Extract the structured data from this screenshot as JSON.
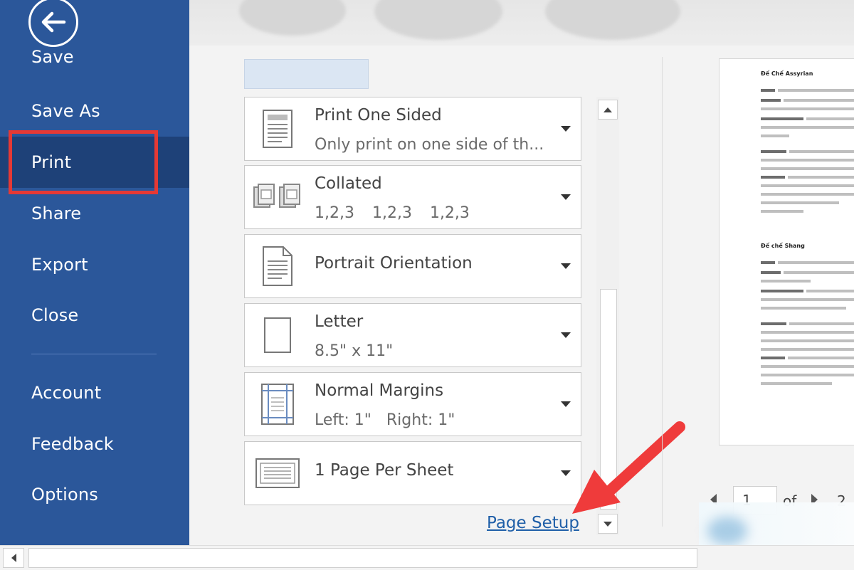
{
  "sidebar": {
    "items": [
      {
        "label": "Save",
        "name": "sidebar-item-save"
      },
      {
        "label": "Save As",
        "name": "sidebar-item-save-as"
      },
      {
        "label": "Print",
        "name": "sidebar-item-print"
      },
      {
        "label": "Share",
        "name": "sidebar-item-share"
      },
      {
        "label": "Export",
        "name": "sidebar-item-export"
      },
      {
        "label": "Close",
        "name": "sidebar-item-close"
      },
      {
        "label": "Account",
        "name": "sidebar-item-account"
      },
      {
        "label": "Feedback",
        "name": "sidebar-item-feedback"
      },
      {
        "label": "Options",
        "name": "sidebar-item-options"
      }
    ],
    "active": "Print",
    "back_icon": "back-arrow-icon"
  },
  "settings": [
    {
      "title": "Print One Sided",
      "sub": "Only print on one side of th...",
      "icon": "one-sided-page-icon"
    },
    {
      "title": "Collated",
      "sub": "1,2,3 1,2,3 1,2,3",
      "icon": "collated-pages-icon"
    },
    {
      "title": "Portrait Orientation",
      "sub": "",
      "icon": "portrait-page-icon"
    },
    {
      "title": "Letter",
      "sub": "8.5\" x 11\"",
      "icon": "letter-page-icon"
    },
    {
      "title": "Normal Margins",
      "sub": "Left: 1\"   Right: 1\"",
      "icon": "margins-icon"
    },
    {
      "title": "1 Page Per Sheet",
      "sub": "",
      "icon": "pages-per-sheet-icon"
    }
  ],
  "page_setup_link": "Page Setup",
  "preview": {
    "headings": [
      "Đế Chế Assyrian",
      "Đế chế Shang"
    ],
    "page_input": "1",
    "of_label": "of",
    "total_pages": "2"
  },
  "colors": {
    "sidebar_bg": "#2b579a",
    "sidebar_active": "#1e4178",
    "highlight": "#e53935",
    "link": "#1f5fa8"
  }
}
